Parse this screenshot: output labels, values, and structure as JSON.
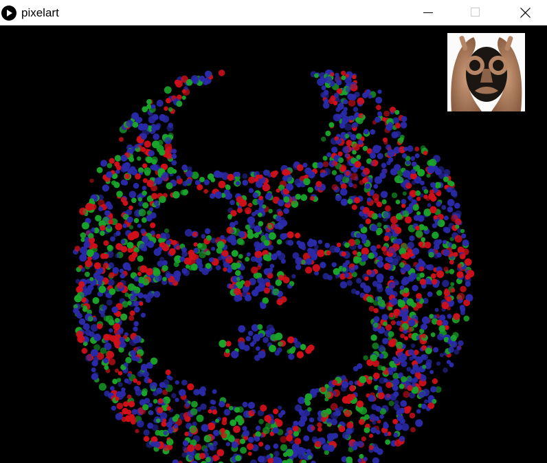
{
  "window": {
    "title": "pixelart"
  },
  "icons": {
    "app": "processing-play-icon",
    "minimize": "minimize-icon",
    "maximize": "maximize-icon",
    "close": "close-icon"
  },
  "colors": {
    "background": "#000000",
    "dot_red": "#d0101a",
    "dot_green": "#1aa32a",
    "dot_blue": "#2a2aa8",
    "titlebar": "#ffffff"
  }
}
